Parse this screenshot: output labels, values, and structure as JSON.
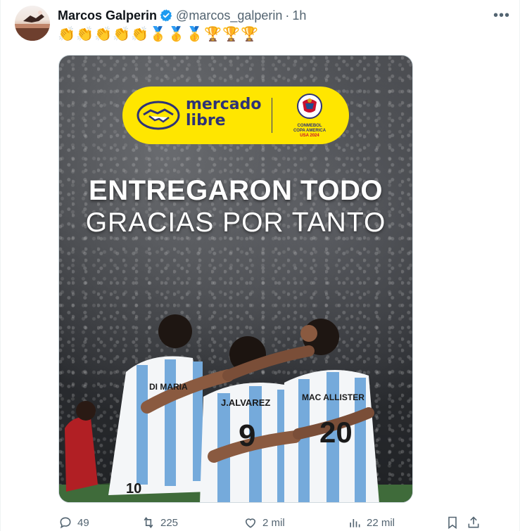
{
  "tweet": {
    "author_name": "Marcos Galperin",
    "handle": "@marcos_galperin",
    "separator": "·",
    "time": "1h",
    "more_label": "•••",
    "emojis": [
      {
        "type": "clap",
        "char": "👏"
      },
      {
        "type": "clap",
        "char": "👏"
      },
      {
        "type": "clap",
        "char": "👏"
      },
      {
        "type": "clap",
        "char": "👏"
      },
      {
        "type": "clap",
        "char": "👏"
      },
      {
        "type": "medal",
        "char": "🥇"
      },
      {
        "type": "medal",
        "char": "🥇"
      },
      {
        "type": "medal",
        "char": "🥇"
      },
      {
        "type": "trophy",
        "char": "🏆"
      },
      {
        "type": "trophy",
        "char": "🏆"
      },
      {
        "type": "trophy",
        "char": "🏆"
      }
    ]
  },
  "media": {
    "brand_line1": "mercado",
    "brand_line2": "libre",
    "copa_caption_1": "CONMEBOL",
    "copa_caption_2": "COPA AMERICA",
    "copa_caption_3": "USA 2024",
    "headline_1": "ENTREGARON TODO",
    "headline_2": "GRACIAS POR TANTO",
    "jersey_names": [
      "DI MARIA",
      "J.ALVAREZ",
      "MAC ALLISTER"
    ],
    "jersey_numbers": [
      "9",
      "20",
      "10"
    ]
  },
  "actions": {
    "replies": "49",
    "reposts": "225",
    "likes": "2 mil",
    "views": "22 mil"
  },
  "colors": {
    "verified": "#1d9bf0",
    "meli_yellow": "#ffe600",
    "meli_navy": "#2d3277",
    "argentina_blue": "#75aadb"
  }
}
